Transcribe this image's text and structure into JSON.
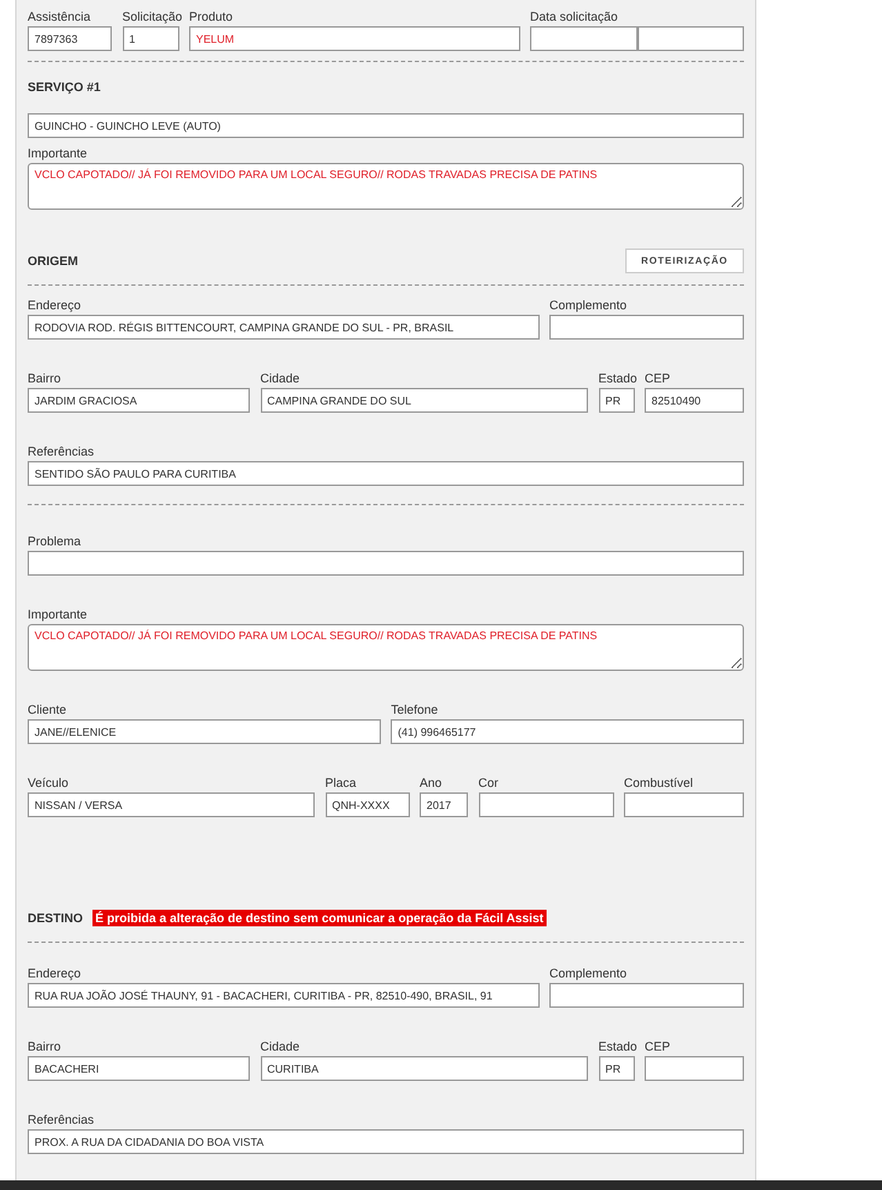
{
  "sections": [
    {
      "kind": "header",
      "rows": [
        {
          "kind": "header",
          "fields": [
            {
              "label": "Assistência",
              "value": "7897363"
            },
            {
              "label": "Solicitação",
              "value": "1"
            },
            {
              "label": "Produto",
              "value": "YELUM",
              "highlight": true
            },
            {
              "label": "Data solicitação",
              "kind": "split"
            }
          ]
        }
      ]
    },
    {
      "kind": "service",
      "title": "SERVIÇO #1",
      "rows": [
        {
          "kind": "full",
          "fields": [
            {
              "value": "GUINCHO - GUINCHO LEVE (AUTO)"
            }
          ]
        },
        {
          "kind": "note",
          "fields": [
            {
              "label": "Importante",
              "value": "VCLO CAPOTADO// JÁ FOI REMOVIDO PARA UM LOCAL SEGURO// RODAS TRAVADAS PRECISA DE PATINS",
              "kind": "textarea",
              "highlight": true
            }
          ]
        }
      ]
    },
    {
      "kind": "place",
      "title": "ORIGEM",
      "button": "ROTEIRIZAÇÃO",
      "rows": [
        {
          "kind": "address",
          "fields": [
            {
              "label": "Endereço",
              "value": "RODOVIA ROD. RÉGIS BITTENCOURT, CAMPINA GRANDE DO SUL - PR, BRASIL"
            },
            {
              "label": "Complemento"
            }
          ]
        },
        {
          "kind": "locality",
          "fields": [
            {
              "label": "Bairro",
              "value": "JARDIM GRACIOSA"
            },
            {
              "label": "Cidade",
              "value": "CAMPINA GRANDE DO SUL"
            },
            {
              "label": "Estado",
              "value": "PR"
            },
            {
              "label": "CEP",
              "value": "82510490"
            }
          ]
        },
        {
          "kind": "full",
          "fields": [
            {
              "label": "Referências",
              "value": "SENTIDO SÃO PAULO PARA CURITIBA"
            }
          ]
        }
      ]
    },
    {
      "kind": "plain",
      "rows": [
        {
          "kind": "full",
          "fields": [
            {
              "label": "Problema"
            }
          ]
        },
        {
          "kind": "note",
          "fields": [
            {
              "label": "Importante",
              "value": "VCLO CAPOTADO// JÁ FOI REMOVIDO PARA UM LOCAL SEGURO// RODAS TRAVADAS PRECISA DE PATINS",
              "kind": "textarea",
              "highlight": true
            }
          ]
        },
        {
          "kind": "contact",
          "fields": [
            {
              "label": "Cliente",
              "value": "JANE//ELENICE"
            },
            {
              "label": "Telefone",
              "value": "(41) 996465177"
            }
          ]
        },
        {
          "kind": "vehicle",
          "fields": [
            {
              "label": "Veículo",
              "value": "NISSAN / VERSA"
            },
            {
              "label": "Placa",
              "value": "QNH-XXXX"
            },
            {
              "label": "Ano",
              "value": "2017"
            },
            {
              "label": "Cor"
            },
            {
              "label": "Combustível"
            }
          ]
        }
      ]
    },
    {
      "kind": "destination",
      "title": "DESTINO",
      "notice": "É proibida a alteração de destino sem comunicar a operação da Fácil Assist",
      "rows": [
        {
          "kind": "address",
          "fields": [
            {
              "label": "Endereço",
              "value": "RUA RUA JOÃO JOSÉ THAUNY, 91 - BACACHERI, CURITIBA - PR, 82510-490, BRASIL, 91"
            },
            {
              "label": "Complemento"
            }
          ]
        },
        {
          "kind": "locality",
          "fields": [
            {
              "label": "Bairro",
              "value": "BACACHERI"
            },
            {
              "label": "Cidade",
              "value": "CURITIBA"
            },
            {
              "label": "Estado",
              "value": "PR"
            },
            {
              "label": "CEP"
            }
          ]
        },
        {
          "kind": "full",
          "fields": [
            {
              "label": "Referências",
              "value": "PROX. A RUA DA CIDADANIA DO BOA VISTA"
            }
          ]
        }
      ]
    }
  ]
}
